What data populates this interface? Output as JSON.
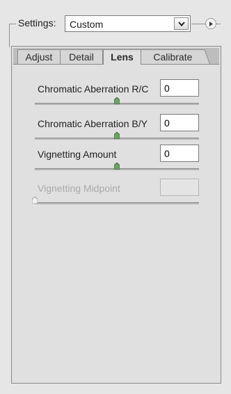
{
  "settings": {
    "label": "Settings:",
    "value": "Custom"
  },
  "tabs": [
    {
      "label": "Adjust",
      "active": false
    },
    {
      "label": "Detail",
      "active": false
    },
    {
      "label": "Lens",
      "active": true
    },
    {
      "label": "Calibrate",
      "active": false
    }
  ],
  "lens": {
    "rows": [
      {
        "label": "Chromatic Aberration R/C",
        "value": "0",
        "slider": 0.5,
        "enabled": true
      },
      {
        "label": "Chromatic Aberration B/Y",
        "value": "0",
        "slider": 0.5,
        "enabled": true
      },
      {
        "label": "Vignetting Amount",
        "value": "0",
        "slider": 0.5,
        "enabled": true
      },
      {
        "label": "Vignetting Midpoint",
        "value": "",
        "slider": 0.0,
        "enabled": false
      }
    ]
  },
  "colors": {
    "background": "#e6e6e6",
    "thumb": "#6fa06a",
    "disabled_text": "#a9a9a9"
  },
  "icons": {
    "dropdown": "chevron-down-icon",
    "menu": "flyout-menu-icon"
  }
}
